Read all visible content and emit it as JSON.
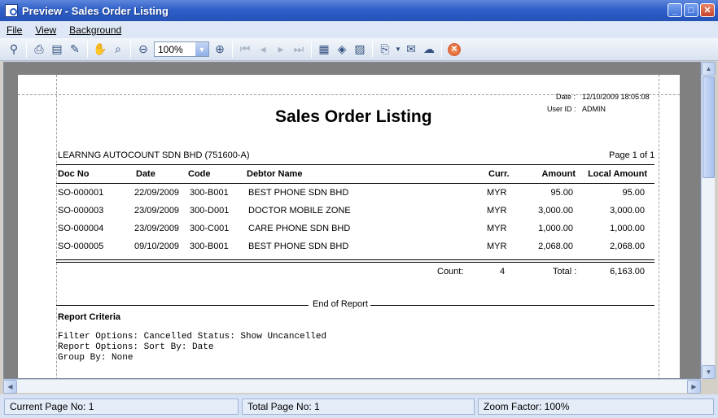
{
  "window": {
    "title": "Preview - Sales Order Listing"
  },
  "menu": [
    "File",
    "View",
    "Background"
  ],
  "toolbar": {
    "zoom": "100%"
  },
  "report": {
    "date_label": "Date :",
    "date_value": "12/10/2009 18:05:08",
    "user_label": "User ID :",
    "user_value": "ADMIN",
    "title": "Sales Order Listing",
    "company": "LEARNNG AUTOCOUNT SDN BHD (751600-A)",
    "page": "Page 1 of 1",
    "columns": [
      "Doc No",
      "Date",
      "Code",
      "Debtor Name",
      "Curr.",
      "Amount",
      "Local Amount"
    ],
    "rows": [
      [
        "SO-000001",
        "22/09/2009",
        "300-B001",
        "BEST PHONE SDN BHD",
        "MYR",
        "95.00",
        "95.00"
      ],
      [
        "SO-000003",
        "23/09/2009",
        "300-D001",
        "DOCTOR MOBILE ZONE",
        "MYR",
        "3,000.00",
        "3,000.00"
      ],
      [
        "SO-000004",
        "23/09/2009",
        "300-C001",
        "CARE PHONE SDN BHD",
        "MYR",
        "1,000.00",
        "1,000.00"
      ],
      [
        "SO-000005",
        "09/10/2009",
        "300-B001",
        "BEST PHONE SDN BHD",
        "MYR",
        "2,068.00",
        "2,068.00"
      ]
    ],
    "count_label": "Count:",
    "count_value": "4",
    "total_label": "Total :",
    "total_value": "6,163.00",
    "end_label": "End of Report",
    "criteria_title": "Report Criteria",
    "criteria_lines": [
      "Filter Options: Cancelled Status: Show Uncancelled",
      "Report Options: Sort By: Date",
      "                Group By: None"
    ]
  },
  "status": {
    "current_page": "Current Page No: 1",
    "total_page": "Total Page No: 1",
    "zoom_factor": "Zoom Factor: 100%"
  }
}
